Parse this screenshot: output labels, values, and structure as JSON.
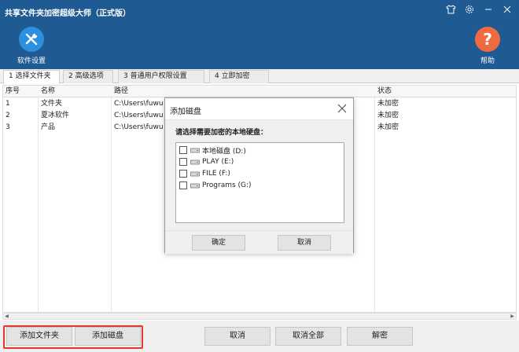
{
  "window": {
    "title": "共享文件夹加密超级大师（正式版）"
  },
  "toolbar": {
    "settings_label": "软件设置",
    "help_label": "帮助",
    "help_glyph": "?"
  },
  "tabs": [
    {
      "label": "1 选择文件夹",
      "active": true
    },
    {
      "label": "2 高级选项",
      "active": false
    },
    {
      "label": "3 普通用户权限设置",
      "active": false
    },
    {
      "label": "4 立即加密",
      "active": false
    }
  ],
  "table": {
    "columns": [
      "序号",
      "名称",
      "路径",
      "状态"
    ],
    "rows": [
      {
        "index": "1",
        "name": "文件夹",
        "path": "C:\\Users\\fuwu",
        "status": "未加密"
      },
      {
        "index": "2",
        "name": "夏冰软件",
        "path": "C:\\Users\\fuwu",
        "status": "未加密"
      },
      {
        "index": "3",
        "name": "产品",
        "path": "C:\\Users\\fuwu",
        "status": "未加密"
      }
    ]
  },
  "footer": {
    "add_folder": "添加文件夹",
    "add_disk": "添加磁盘",
    "cancel": "取消",
    "cancel_all": "取消全部",
    "decrypt": "解密"
  },
  "dialog": {
    "title": "添加磁盘",
    "prompt": "请选择需要加密的本地硬盘：",
    "disks": [
      {
        "label": "本地磁盘 (D:)",
        "checked": false
      },
      {
        "label": "PLAY (E:)",
        "checked": false
      },
      {
        "label": "FILE (F:)",
        "checked": false
      },
      {
        "label": "Programs (G:)",
        "checked": false
      }
    ],
    "ok": "确定",
    "cancel": "取消"
  },
  "colors": {
    "header_bg": "#1f5a93",
    "highlight": "#e23a31",
    "settings_icon_bg": "#2d8fe0",
    "help_icon_bg": "#ef6a3e"
  }
}
